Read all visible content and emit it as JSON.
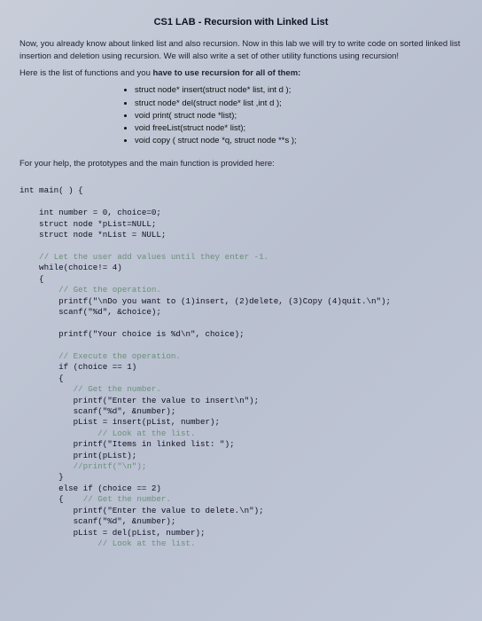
{
  "title": "CS1 LAB  - Recursion with Linked List",
  "intro": "Now, you already know about linked list and also recursion. Now in this lab we will try to write code on sorted linked list insertion and deletion using recursion. We will also write a set of other utility functions using recursion!",
  "listlead_a": "Here is the list of functions and you ",
  "listlead_b": "have to use recursion for all of them:",
  "funcs": {
    "f0": "struct node* insert(struct node* list, int d );",
    "f1": "struct node* del(struct node* list ,int d );",
    "f2": "void print( struct node *list);",
    "f3": "void freeList(struct node* list);",
    "f4": "void copy ( struct node *q, struct node **s );"
  },
  "protolead": "For your help, the prototypes and the main function is provided here:",
  "code": {
    "l01": "int main( ) {",
    "l02": "    int number = 0, choice=0;",
    "l03": "    struct node *pList=NULL;",
    "l04": "    struct node *nList = NULL;",
    "l05": "    // Let the user add values until they enter -1.",
    "l06": "    while(choice!= 4)",
    "l07": "    {",
    "l08": "        // Get the operation.",
    "l09": "        printf(\"\\nDo you want to (1)insert, (2)delete, (3)Copy (4)quit.\\n\");",
    "l10": "        scanf(\"%d\", &choice);",
    "l11": "        printf(\"Your choice is %d\\n\", choice);",
    "l12": "        // Execute the operation.",
    "l13": "        if (choice == 1)",
    "l14": "        {",
    "l15": "           // Get the number.",
    "l16": "           printf(\"Enter the value to insert\\n\");",
    "l17": "           scanf(\"%d\", &number);",
    "l18": "           pList = insert(pList, number);",
    "l19": "                // Look at the list.",
    "l20": "           printf(\"Items in linked list: \");",
    "l21": "           print(pList);",
    "l22": "           //printf(\"\\n\");",
    "l23": "        }",
    "l24": "        else if (choice == 2)",
    "l25": "        {    // Get the number.",
    "l26": "           printf(\"Enter the value to delete.\\n\");",
    "l27": "           scanf(\"%d\", &number);",
    "l28": "           pList = del(pList, number);",
    "l29": "                // Look at the list."
  }
}
